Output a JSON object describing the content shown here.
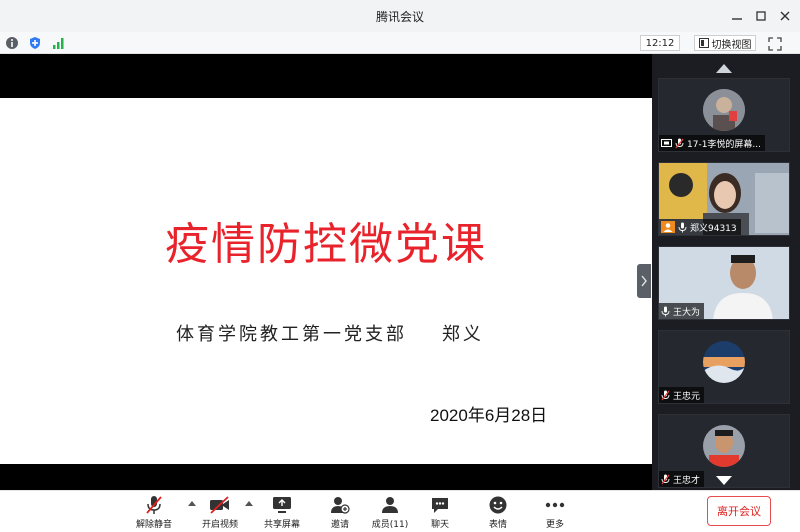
{
  "window": {
    "title": "腾讯会议"
  },
  "status": {
    "clock": "12:12",
    "switch_view_label": "切换视图"
  },
  "slide": {
    "title": "疫情防控微党课",
    "subtitle": "体育学院教工第一党支部    郑义",
    "date": "2020年6月28日"
  },
  "participants": [
    {
      "name": "17-1李悦的屏幕...",
      "icon": "screen-share-icon",
      "muted": true
    },
    {
      "name": "郑义94313",
      "icon": "host-icon",
      "muted": false
    },
    {
      "name": "王大为",
      "icon": "",
      "muted": false
    },
    {
      "name": "王忠元",
      "icon": "",
      "muted": true
    },
    {
      "name": "王忠才",
      "icon": "",
      "muted": true
    }
  ],
  "toolbar": {
    "unmute": "解除静音",
    "start_video": "开启视频",
    "share_screen": "共享屏幕",
    "invite": "邀请",
    "members": "成员(11)",
    "chat": "聊天",
    "emoji": "表情",
    "more": "更多",
    "leave": "离开会议"
  },
  "colors": {
    "slide_title": "#e8232b",
    "leave_button": "#e02020",
    "panel_bg": "#1b1d22"
  }
}
